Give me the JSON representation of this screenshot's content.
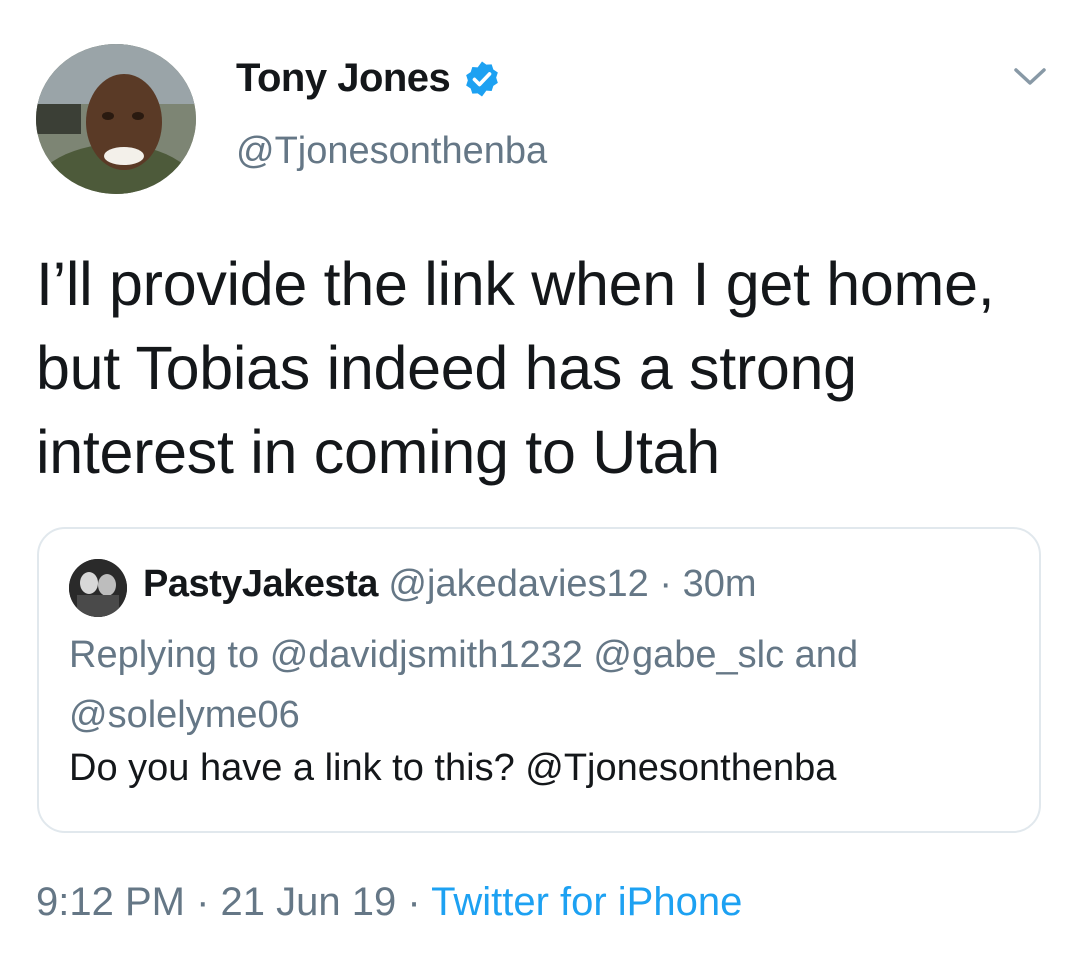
{
  "author": {
    "name": "Tony Jones",
    "handle": "@Tjonesonthenba",
    "verified": true
  },
  "tweet": {
    "text": "I’ll provide the link when I get home, but Tobias indeed has a strong interest in coming to Utah"
  },
  "quoted_tweet": {
    "name": "PastyJakesta",
    "handle": "@jakedavies12",
    "separator": "·",
    "time": "30m",
    "replying_prefix": "Replying to",
    "replying_users": "@davidjsmith1232 @gabe_slc and @solelyme06",
    "text": "Do you have a link to this? @Tjonesonthenba"
  },
  "footer": {
    "time": "9:12 PM",
    "separator": "·",
    "date": "21 Jun 19",
    "source": "Twitter for iPhone"
  },
  "colors": {
    "primary_text": "#14171a",
    "secondary_text": "#657786",
    "accent": "#1da1f2",
    "border": "#e1e8ed"
  },
  "icons": {
    "verified": "verified-badge-icon",
    "menu": "chevron-down-icon"
  }
}
